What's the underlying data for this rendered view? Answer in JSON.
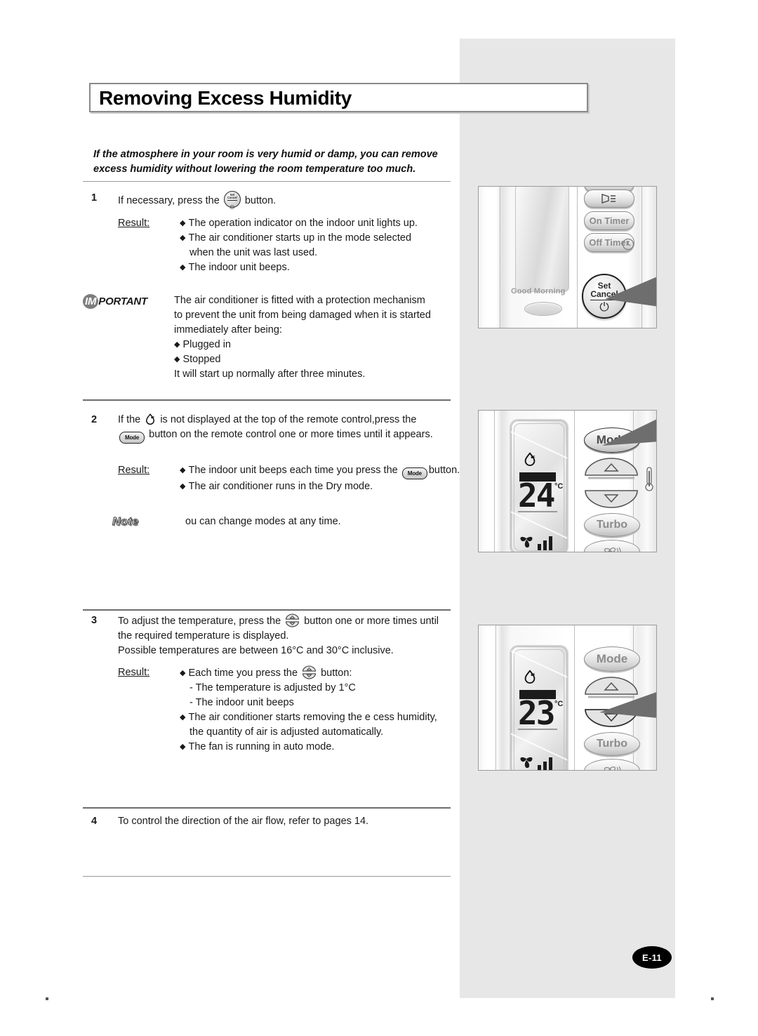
{
  "page": {
    "title": "Removing Excess Humidity",
    "page_number": "E-11",
    "intro": "If the atmosphere in your room is very humid or damp, you can remove excess humidity without lowering the room temperature too much."
  },
  "steps": [
    {
      "number": "1",
      "text_before_icon": "If necessary, press the",
      "icon": "set-cancel-button-icon",
      "text_after_icon": "button.",
      "result_label": "Result:",
      "results": [
        "The operation indicator on the indoor unit lights up.",
        "The air conditioner starts up in the mode selected",
        "when the unit was last used.",
        "The indoor unit beeps."
      ]
    },
    {
      "number": "2",
      "line1_a": "If the",
      "line1_icon": "dry-mode-icon",
      "line1_b": "is not displayed at the top of the remote control,press the",
      "line2_icon": "mode-button-icon",
      "line2_b": "button on the remote control one or more times until it appears.",
      "result_label": "Result:",
      "results": [
        "The indoor unit beeps each time you press the",
        "button.",
        "The air conditioner runs in the Dry mode."
      ]
    },
    {
      "number": "3",
      "line1_a": "To adjust the temperature, press the",
      "line1_icon": "temp-updown-button-icon",
      "line1_b": "button one or more times until",
      "line2": "the required temperature is displayed.",
      "line3": "Possible temperatures are between 16°C and 30°C inclusive.",
      "result_label": "Result:",
      "results": [
        "Each time you press the",
        "button:",
        "- The temperature is adjusted by 1°C",
        "- The indoor unit beeps",
        "The air conditioner starts removing the e    cess humidity,",
        "the quantity of air is adjusted automatically.",
        "The fan is running in auto mode."
      ]
    },
    {
      "number": "4",
      "text": "To control the direction of the air flow, refer to pages 14."
    }
  ],
  "important": {
    "badge_prefix": "IM",
    "badge_suffix": "PORTANT",
    "lines": [
      "The air conditioner is fitted with a protection mechanism",
      "to prevent the unit from being damaged when it is started",
      "immediately after being:"
    ],
    "bullets": [
      "Plugged in",
      "Stopped"
    ],
    "closing": "It will start up normally after three minutes."
  },
  "note": {
    "badge": "Note",
    "text": "ou can change modes at any time."
  },
  "illustrations": [
    {
      "name": "indoor-unit-panel",
      "good_morning_label": "Good Morning",
      "buttons": [
        "On Timer",
        "Off Timer"
      ],
      "set_cancel": {
        "line1": "Set",
        "line2": "Cancel"
      },
      "icons": [
        "airflow-icon",
        "clock-icon",
        "power-icon"
      ],
      "callout_target": "set-cancel-button"
    },
    {
      "name": "remote-control-mode",
      "display_temperature": "24",
      "display_unit": "°C",
      "display_mode_icon": "dry-mode-icon",
      "buttons": [
        "Mode",
        "Turbo"
      ],
      "icons": [
        "up-arrow-icon",
        "down-arrow-icon",
        "thermometer-icon",
        "fan-icon",
        "signal-icon"
      ],
      "callout_target": "mode-button"
    },
    {
      "name": "remote-control-temperature",
      "display_temperature": "23",
      "display_unit": "°C",
      "display_mode_icon": "dry-mode-icon",
      "buttons": [
        "Mode",
        "Turbo"
      ],
      "icons": [
        "up-arrow-icon",
        "down-arrow-icon",
        "fan-icon",
        "signal-icon"
      ],
      "callout_target": "down-arrow-button"
    }
  ],
  "colors": {
    "panel_gray": "#e7e7e7",
    "rule_gray": "#9a9a9a",
    "text": "#1a1a1a",
    "callout_arrow": "#6e6e6e"
  }
}
